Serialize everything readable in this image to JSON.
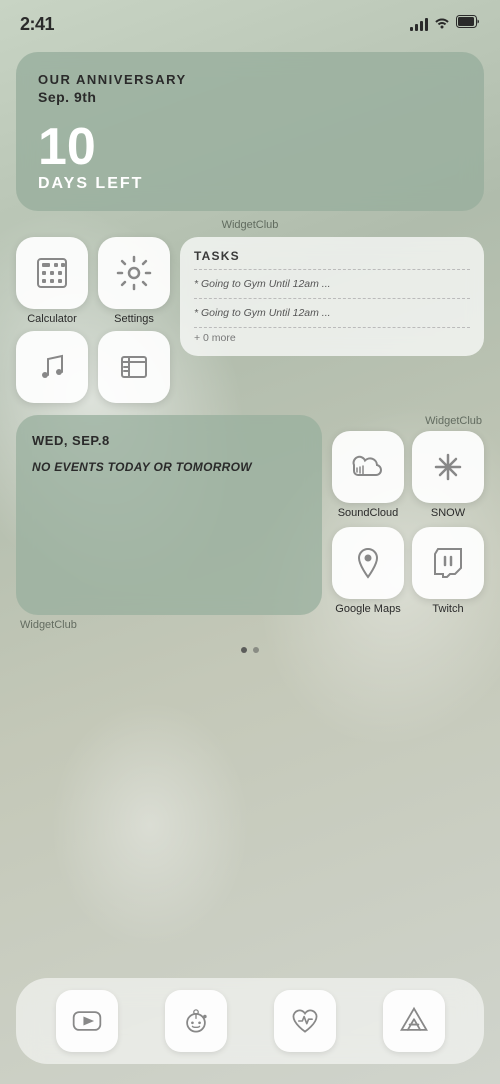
{
  "status": {
    "time": "2:41"
  },
  "anniversary_widget": {
    "title": "Our anniversary",
    "date": "Sep. 9th",
    "days_number": "10",
    "days_label": "Days Left",
    "widgetclub": "WidgetClub"
  },
  "apps": {
    "calculator": {
      "label": "Calculator"
    },
    "settings": {
      "label": "Settings"
    },
    "music": {
      "label": ""
    },
    "books": {
      "label": ""
    }
  },
  "tasks_widget": {
    "title": "Tasks",
    "item1": "* Going to Gym Until 12am ...",
    "item2": "* Going to Gym Until 12am ...",
    "more": "+ 0 more",
    "widgetclub": "WidgetClub"
  },
  "calendar_widget": {
    "day": "Wed, Sep.8",
    "note": "No events today or tomorrow",
    "widgetclub": "WidgetClub"
  },
  "right_apps": {
    "soundcloud": {
      "label": "SoundCloud"
    },
    "snow": {
      "label": "SNOW"
    },
    "googlemaps": {
      "label": "Google Maps"
    },
    "twitch": {
      "label": "Twitch"
    }
  },
  "page_dots": [
    {
      "active": true
    },
    {
      "active": false
    }
  ],
  "dock": {
    "youtube": {
      "label": "YouTube"
    },
    "reddit": {
      "label": "Reddit"
    },
    "health": {
      "label": "Health"
    },
    "appstore": {
      "label": "App Store"
    }
  }
}
